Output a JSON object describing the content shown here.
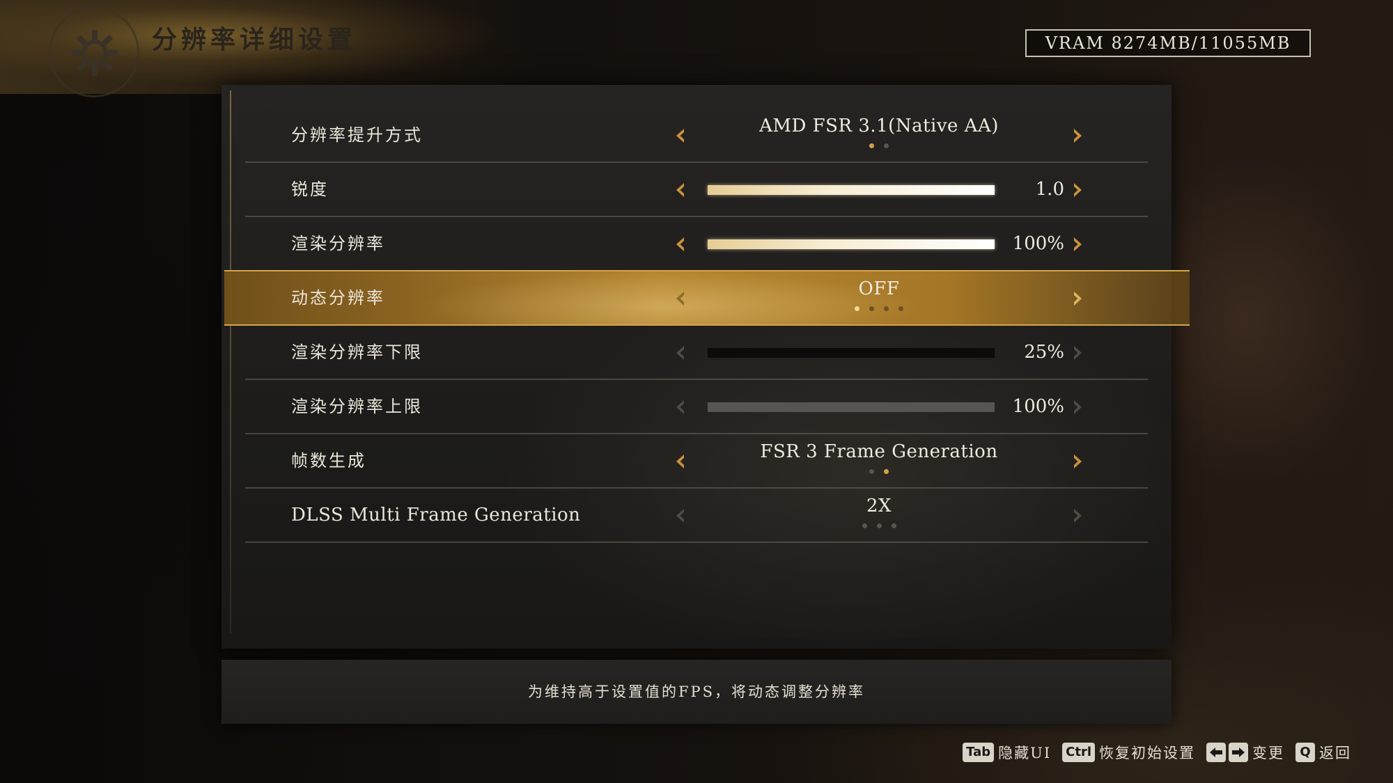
{
  "header": {
    "title": "分辨率详细设置",
    "vram": "VRAM 8274MB/11055MB"
  },
  "settings": [
    {
      "label": "分辨率提升方式",
      "type": "option",
      "value": "AMD FSR 3.1(Native AA)",
      "option_count": 2,
      "option_index": 0
    },
    {
      "label": "锐度",
      "type": "slider",
      "value": "1.0",
      "fill_fraction": 1.0
    },
    {
      "label": "渲染分辨率",
      "type": "slider",
      "value": "100%",
      "fill_fraction": 1.0
    },
    {
      "label": "动态分辨率",
      "type": "option",
      "value": "OFF",
      "option_count": 4,
      "option_index": 0,
      "selected": true
    },
    {
      "label": "渲染分辨率下限",
      "type": "slider",
      "value": "25%",
      "fill_fraction": 0.0,
      "disabled": true
    },
    {
      "label": "渲染分辨率上限",
      "type": "slider",
      "value": "100%",
      "fill_fraction": 1.0,
      "disabled": true
    },
    {
      "label": "帧数生成",
      "type": "option",
      "value": "FSR 3 Frame Generation",
      "option_count": 2,
      "option_index": 1
    },
    {
      "label": "DLSS Multi Frame Generation",
      "type": "option",
      "value": "2X",
      "option_count": 3,
      "option_index": -1,
      "disabled": true
    }
  ],
  "description": "为维持高于设置值的FPS，将动态调整分辨率",
  "footer": {
    "tab_key": "Tab",
    "hide_ui": "隐藏UI",
    "ctrl_key": "Ctrl",
    "reset": "恢复初始设置",
    "change": "变更",
    "q_key": "Q",
    "back": "返回"
  },
  "colors": {
    "accent": "#c9923e",
    "selected_bar": "#b58630",
    "panel": "#1f1e1c"
  }
}
